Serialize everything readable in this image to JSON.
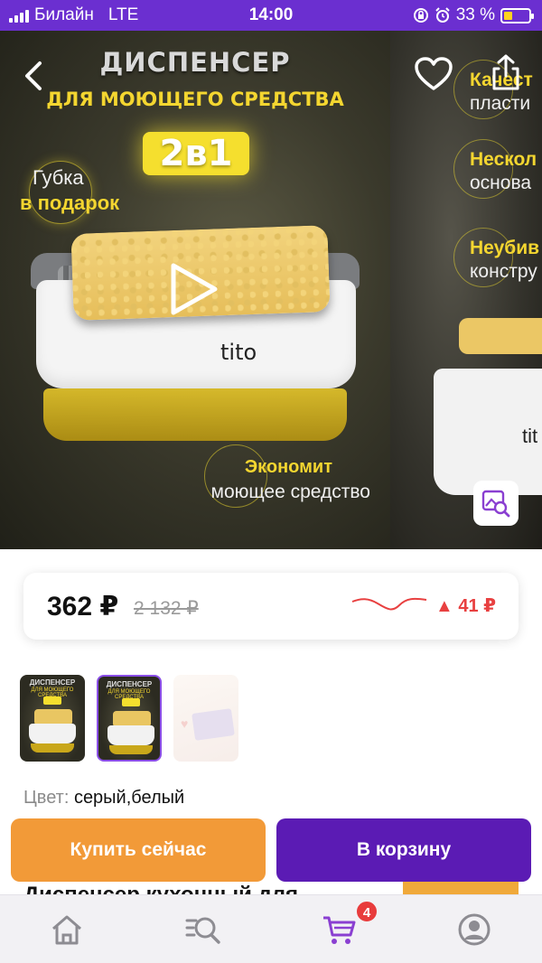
{
  "status_bar": {
    "carrier": "Билайн",
    "network": "LTE",
    "time": "14:00",
    "battery_percent": "33 %"
  },
  "gallery": {
    "title": "ДИСПЕНСЕР",
    "subtitle": "ДЛЯ МОЮЩЕГО СРЕДСТВА",
    "badge": "2в1",
    "gift_line1": "Губка",
    "gift_line2": "в подарок",
    "brand": "tito",
    "econ_line1": "Экономит",
    "econ_line2": "моющее средство",
    "next_slide_features": [
      {
        "title": "Качест",
        "text": "пласти"
      },
      {
        "title": "Нескол",
        "text": "основа"
      },
      {
        "title": "Неубив",
        "text": "констру"
      }
    ],
    "next_brand": "tit",
    "icons": [
      "chevron-left-icon",
      "heart-icon",
      "share-icon",
      "play-icon",
      "image-search-icon"
    ]
  },
  "price": {
    "current": "362 ₽",
    "old": "2 132 ₽",
    "change": "▲ 41 ₽",
    "change_color": "#e84040"
  },
  "thumbnails": [
    {
      "title": "ДИСПЕНСЕР",
      "subtitle": "ДЛЯ МОЮЩЕГО СРЕДСТВА",
      "selected": false
    },
    {
      "title": "ДИСПЕНСЕР",
      "subtitle": "ДЛЯ МОЮЩЕГО СРЕДСТВА",
      "selected": true
    },
    {
      "title": "",
      "subtitle": "",
      "selected": false
    }
  ],
  "color": {
    "label": "Цвет:",
    "value": "серый,белый"
  },
  "description_title": "Диспенсер кухонный для",
  "actions": {
    "buy_now": "Купить сейчас",
    "add_to_cart": "В корзину"
  },
  "tab_bar": {
    "tabs": [
      "home-icon",
      "search-icon",
      "cart-icon",
      "profile-icon"
    ],
    "cart_count": "4",
    "active_color": "#8a3fd1"
  },
  "colors": {
    "brand_purple": "#6b2fd0",
    "buy_orange": "#f29a38",
    "cart_purple": "#5b1bb4",
    "accent_yellow": "#f4d630"
  }
}
